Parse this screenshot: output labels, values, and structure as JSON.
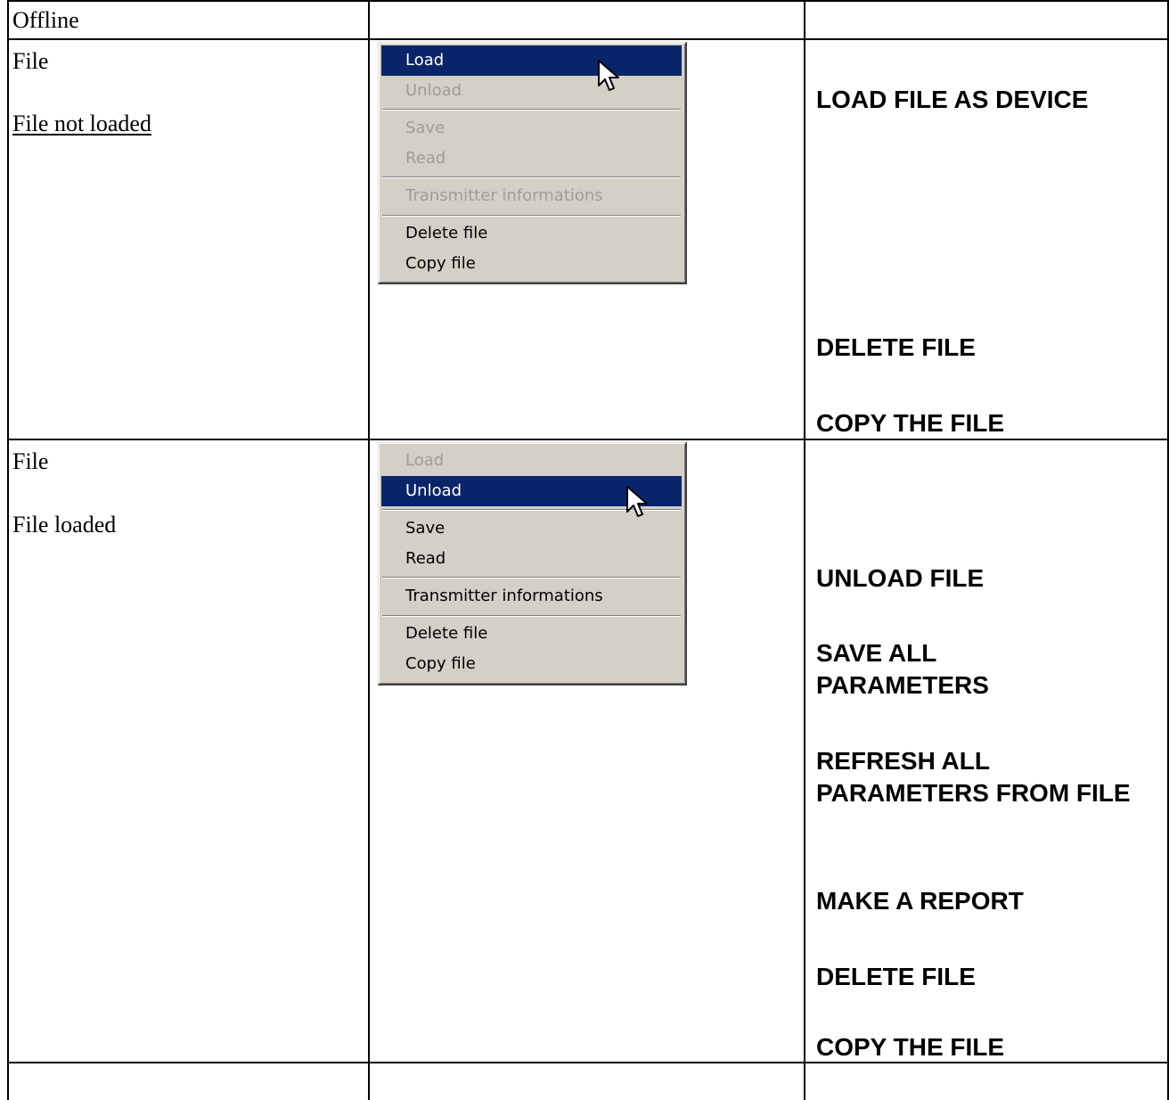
{
  "table": {
    "header": {
      "col1": "Offline",
      "col2": "",
      "col3": ""
    },
    "row1": {
      "label": "File",
      "status": "File not loaded",
      "menu": {
        "load": "Load",
        "unload": "Unload",
        "save": "Save",
        "read": "Read",
        "transmitter": "Transmitter informations",
        "delete": "Delete file",
        "copy": "Copy file"
      },
      "actions": {
        "load": "LOAD FILE AS DEVICE",
        "delete": "DELETE FILE",
        "copy": "COPY THE FILE"
      }
    },
    "row2": {
      "label": "File",
      "status": "File loaded",
      "menu": {
        "load": "Load",
        "unload": "Unload",
        "save": "Save",
        "read": "Read",
        "transmitter": "Transmitter informations",
        "delete": "Delete file",
        "copy": "Copy file"
      },
      "actions": {
        "unload": "UNLOAD FILE",
        "save": "SAVE ALL PARAMETERS",
        "refresh": "REFRESH ALL PARAMETERS FROM FILE",
        "report": "MAKE A REPORT",
        "delete": "DELETE FILE",
        "copy": "COPY THE FILE"
      }
    }
  },
  "colors": {
    "menu_bg": "#d4d0c8",
    "highlight": "#0a246a",
    "disabled_text": "#a09d96"
  },
  "icons": {
    "cursor": "arrow-pointer-icon"
  }
}
